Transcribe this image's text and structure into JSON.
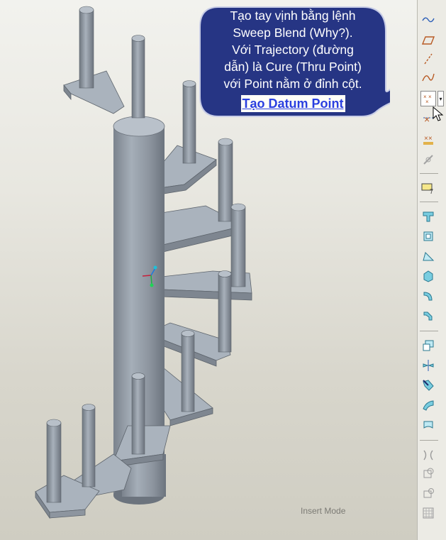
{
  "callout": {
    "lines": [
      "Tạo tay vịnh bằng lệnh",
      "Sweep Blend (Why?).",
      "Với Trajectory (đường",
      "dẫn) là Cure (Thru Point)",
      "với Point nằm ở đỉnh cột."
    ],
    "link": "Tạo Datum Point"
  },
  "status": {
    "mode": "Insert Mode"
  },
  "toolbar": {
    "tools": [
      "sketch-curve-icon",
      "datum-plane-icon",
      "datum-axis-icon",
      "datum-curve-icon",
      "datum-point-icon",
      "offset-point-icon",
      "field-point-icon",
      "coordinate-system-icon",
      "annotation-icon",
      "extrude-icon",
      "revolve-icon",
      "rib-icon",
      "hole-icon",
      "round-icon",
      "chamfer-icon",
      "shell-icon",
      "draft-icon",
      "pattern-icon",
      "merge-icon",
      "trim-icon",
      "offset-icon",
      "thicken-icon"
    ]
  },
  "colors": {
    "steel": "#a9b2bb",
    "steel_dark": "#6e7680",
    "callout_bg": "#263584",
    "link": "#2a3fe0"
  }
}
